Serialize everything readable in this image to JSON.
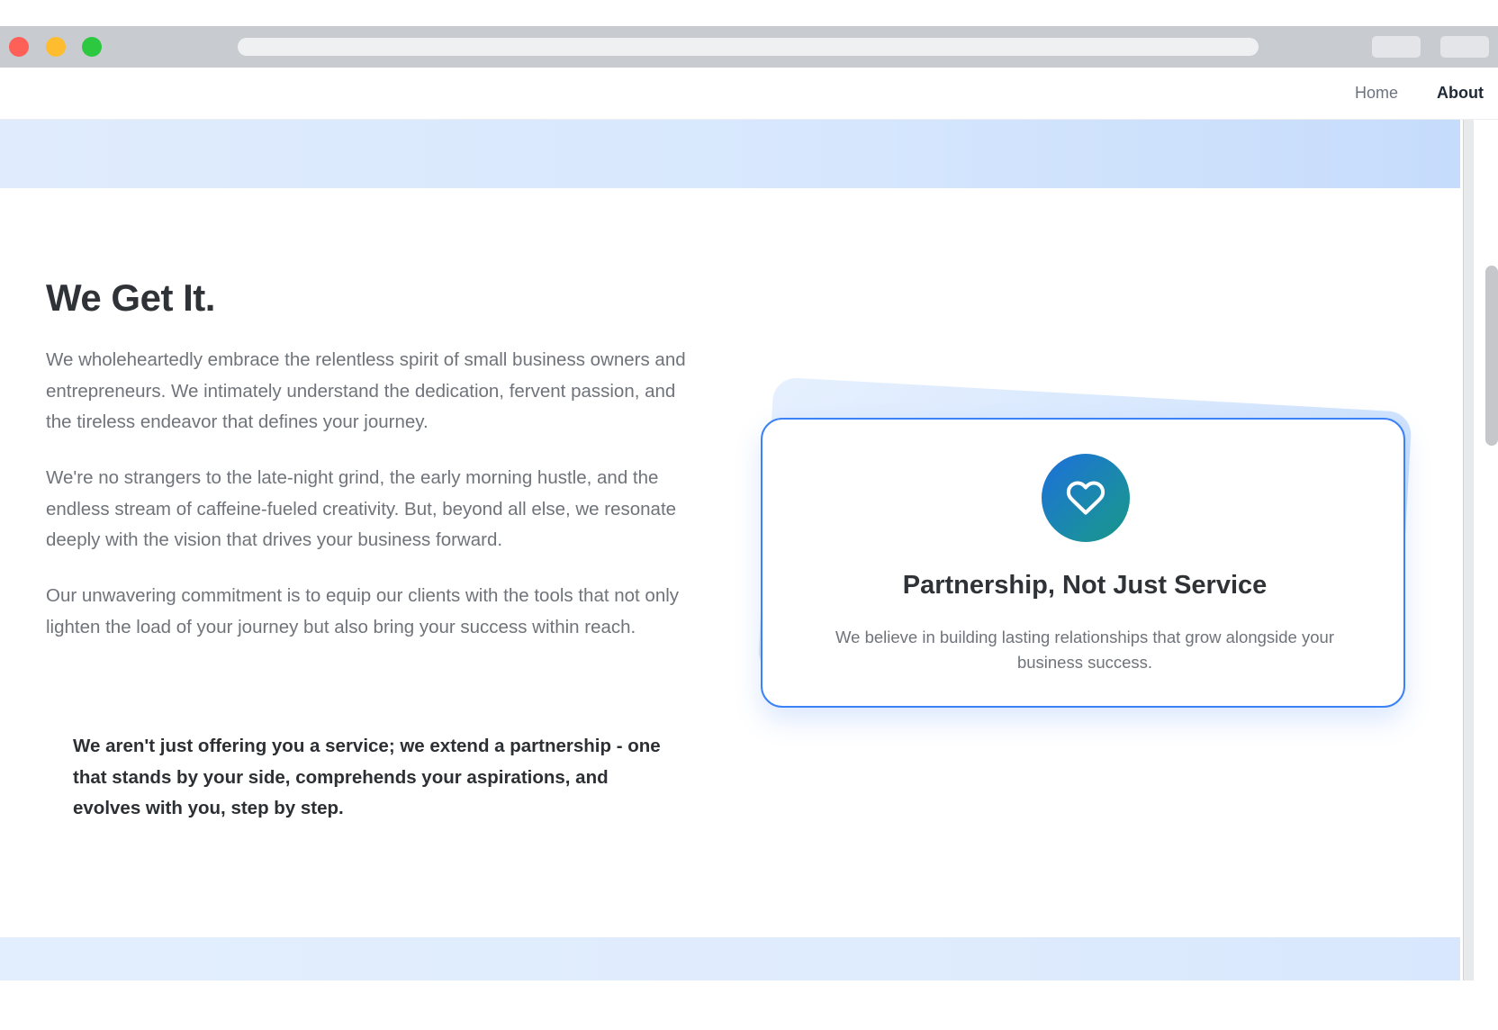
{
  "browser": {
    "buttons": [
      "close",
      "minimize",
      "maximize"
    ]
  },
  "nav": {
    "items": [
      {
        "label": "Home",
        "active": false
      },
      {
        "label": "About",
        "active": true
      }
    ]
  },
  "about": {
    "heading": "We Get It.",
    "paragraphs": [
      "We wholeheartedly embrace the relentless spirit of small business owners and entrepreneurs. We intimately understand the dedication, fervent passion, and the tireless endeavor that defines your journey.",
      "We're no strangers to the late-night grind, the early morning hustle, and the endless stream of caffeine-fueled creativity. But, beyond all else, we resonate deeply with the vision that drives your business forward.",
      "Our unwavering commitment is to equip our clients with the tools that not only lighten the load of your journey but also bring your success within reach."
    ],
    "quote": "We aren't just offering you a service; we extend a partnership - one that stands by your side, comprehends your aspirations, and evolves with you, step by step."
  },
  "card": {
    "icon": "heart-icon",
    "title": "Partnership, Not Just Service",
    "text": "We believe in building lasting relationships that grow alongside your business success."
  },
  "colors": {
    "accent": "#3b82f6",
    "icon_gradient_start": "#1d6fdc",
    "icon_gradient_end": "#169488",
    "band": "#d7e7fd"
  }
}
